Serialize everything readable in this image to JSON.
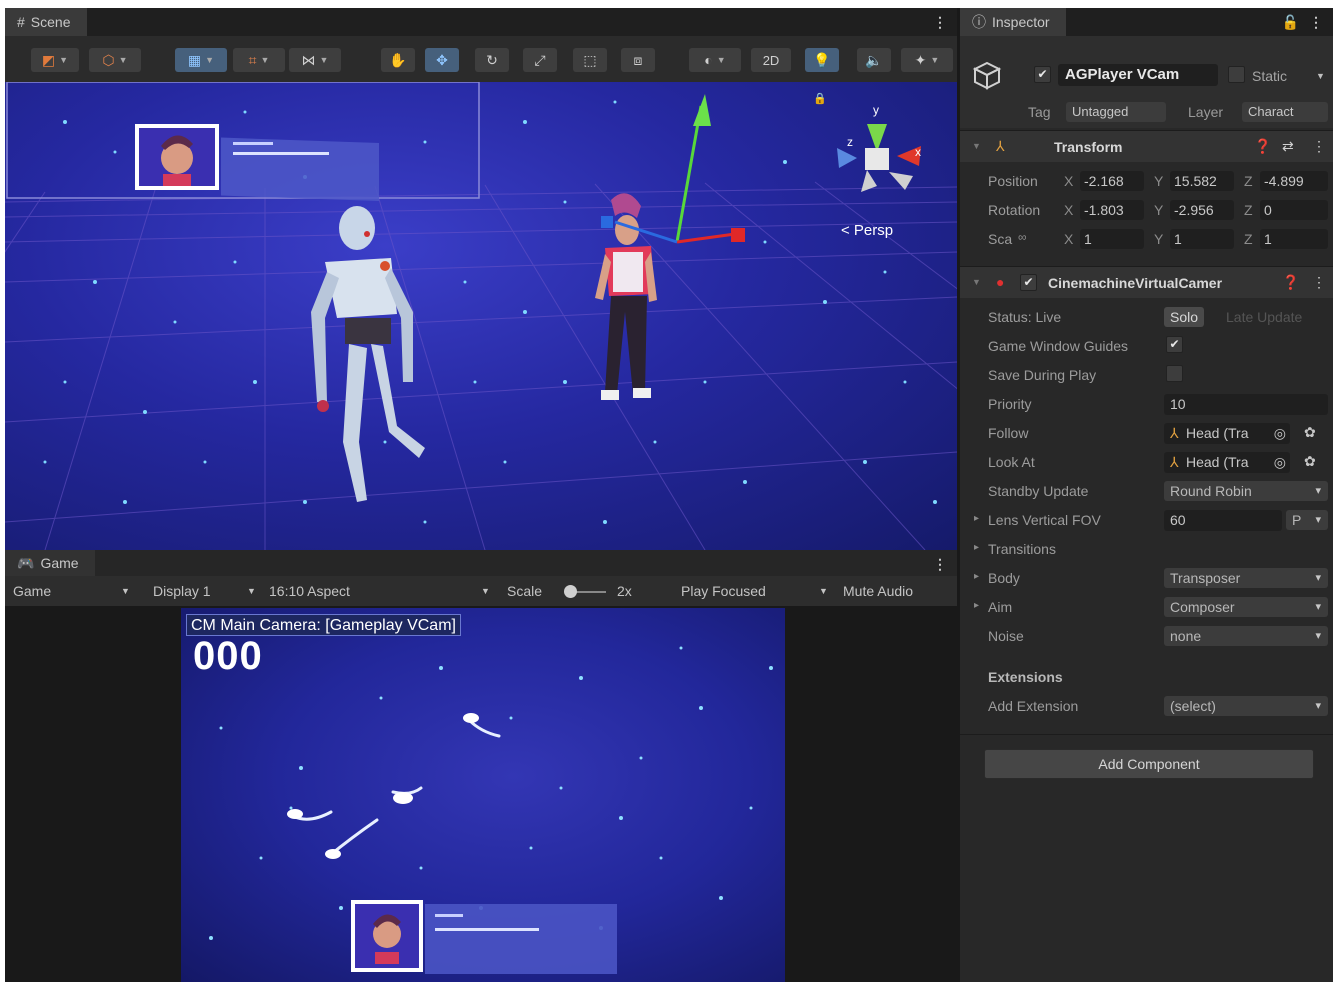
{
  "scene": {
    "tab_label": "Scene",
    "toolbar": {
      "mode_2d": "2D"
    },
    "persp_label": "< Persp",
    "gizmo": {
      "y": "y",
      "x": "x",
      "z": "z"
    }
  },
  "game": {
    "tab_label": "Game",
    "toolbar": {
      "game_dropdown": "Game",
      "display": "Display 1",
      "aspect": "16:10 Aspect",
      "scale_label": "Scale",
      "scale_value": "2x",
      "play_mode": "Play Focused",
      "mute": "Mute Audio"
    },
    "camera_label": "CM Main Camera: [Gameplay VCam]",
    "score": "000"
  },
  "inspector": {
    "tab_label": "Inspector",
    "object": {
      "name": "AGPlayer VCam",
      "static_label": "Static",
      "tag_label": "Tag",
      "tag_value": "Untagged",
      "layer_label": "Layer",
      "layer_value": "Charact"
    },
    "transform": {
      "title": "Transform",
      "position_label": "Position",
      "rotation_label": "Rotation",
      "scale_label": "Sca",
      "position": {
        "x": "-2.168",
        "y": "15.582",
        "z": "-4.899"
      },
      "rotation": {
        "x": "-1.803",
        "y": "-2.956",
        "z": "0"
      },
      "scale": {
        "x": "1",
        "y": "1",
        "z": "1"
      }
    },
    "vcam": {
      "title": "CinemachineVirtualCamer",
      "status_label": "Status: Live",
      "solo_button": "Solo",
      "late_update": "Late Update",
      "guides_label": "Game Window Guides",
      "save_label": "Save During Play",
      "priority_label": "Priority",
      "priority_value": "10",
      "follow_label": "Follow",
      "follow_value": "Head (Tra",
      "lookat_label": "Look At",
      "lookat_value": "Head (Tra",
      "standby_label": "Standby Update",
      "standby_value": "Round Robin",
      "fov_label": "Lens Vertical FOV",
      "fov_value": "60",
      "fov_mode": "P",
      "transitions_label": "Transitions",
      "body_label": "Body",
      "body_value": "Transposer",
      "aim_label": "Aim",
      "aim_value": "Composer",
      "noise_label": "Noise",
      "noise_value": "none",
      "extensions_label": "Extensions",
      "add_extension_label": "Add Extension",
      "add_extension_value": "(select)"
    },
    "add_component": "Add Component"
  }
}
